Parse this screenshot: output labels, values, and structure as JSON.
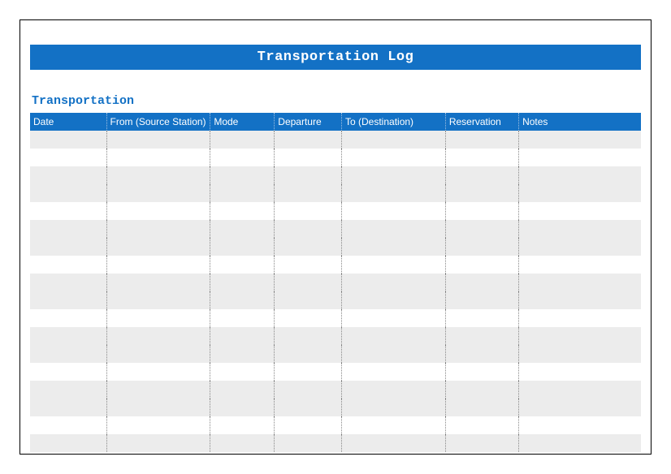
{
  "title": "Transportation Log",
  "section_title": "Transportation",
  "columns": [
    {
      "label": "Date"
    },
    {
      "label": "From (Source Station)"
    },
    {
      "label": "Mode"
    },
    {
      "label": "Departure"
    },
    {
      "label": "To (Destination)"
    },
    {
      "label": "Reservation"
    },
    {
      "label": "Notes"
    }
  ],
  "rows": [
    {
      "shaded": true,
      "cells": [
        "",
        "",
        "",
        "",
        "",
        "",
        ""
      ]
    },
    {
      "shaded": false,
      "cells": [
        "",
        "",
        "",
        "",
        "",
        "",
        ""
      ]
    },
    {
      "shaded": true,
      "cells": [
        "",
        "",
        "",
        "",
        "",
        "",
        ""
      ]
    },
    {
      "shaded": true,
      "cells": [
        "",
        "",
        "",
        "",
        "",
        "",
        ""
      ]
    },
    {
      "shaded": false,
      "cells": [
        "",
        "",
        "",
        "",
        "",
        "",
        ""
      ]
    },
    {
      "shaded": true,
      "cells": [
        "",
        "",
        "",
        "",
        "",
        "",
        ""
      ]
    },
    {
      "shaded": true,
      "cells": [
        "",
        "",
        "",
        "",
        "",
        "",
        ""
      ]
    },
    {
      "shaded": false,
      "cells": [
        "",
        "",
        "",
        "",
        "",
        "",
        ""
      ]
    },
    {
      "shaded": true,
      "cells": [
        "",
        "",
        "",
        "",
        "",
        "",
        ""
      ]
    },
    {
      "shaded": true,
      "cells": [
        "",
        "",
        "",
        "",
        "",
        "",
        ""
      ]
    },
    {
      "shaded": false,
      "cells": [
        "",
        "",
        "",
        "",
        "",
        "",
        ""
      ]
    },
    {
      "shaded": true,
      "cells": [
        "",
        "",
        "",
        "",
        "",
        "",
        ""
      ]
    },
    {
      "shaded": true,
      "cells": [
        "",
        "",
        "",
        "",
        "",
        "",
        ""
      ]
    },
    {
      "shaded": false,
      "cells": [
        "",
        "",
        "",
        "",
        "",
        "",
        ""
      ]
    },
    {
      "shaded": true,
      "cells": [
        "",
        "",
        "",
        "",
        "",
        "",
        ""
      ]
    },
    {
      "shaded": true,
      "cells": [
        "",
        "",
        "",
        "",
        "",
        "",
        ""
      ]
    },
    {
      "shaded": false,
      "cells": [
        "",
        "",
        "",
        "",
        "",
        "",
        ""
      ]
    },
    {
      "shaded": true,
      "cells": [
        "",
        "",
        "",
        "",
        "",
        "",
        ""
      ]
    }
  ]
}
